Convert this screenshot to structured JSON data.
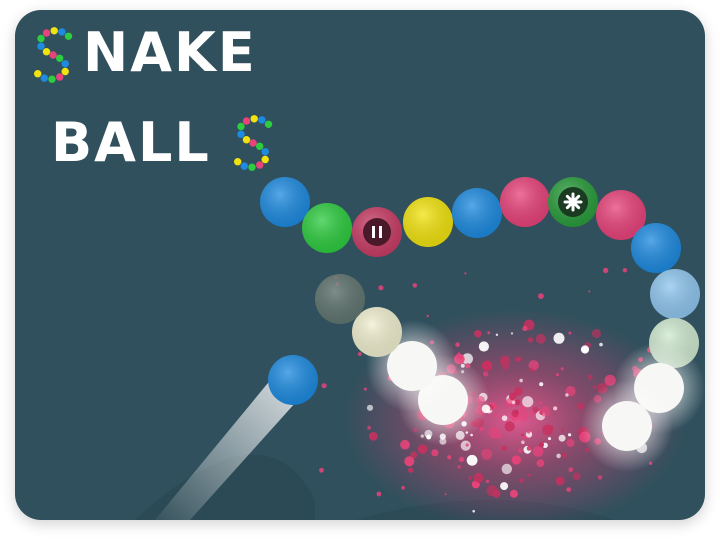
{
  "title": {
    "line1_letters": "NAKE",
    "line2_letters": "BALL",
    "dotted_letter": "S"
  },
  "colors": {
    "background": "#31505d",
    "blue": "#1e8be0",
    "green": "#2ecc40",
    "yellow": "#f2e30f",
    "pink": "#e8437a",
    "pause_ball": "#c93d66",
    "star_ball": "#2a9d3c"
  },
  "snake_balls": [
    {
      "color": "blue"
    },
    {
      "color": "green"
    },
    {
      "color": "pink",
      "icon": "pause-icon"
    },
    {
      "color": "yellow"
    },
    {
      "color": "blue"
    },
    {
      "color": "pink"
    },
    {
      "color": "green",
      "icon": "star-icon"
    },
    {
      "color": "pink"
    },
    {
      "color": "blue"
    },
    {
      "color": "light-blue"
    },
    {
      "color": "pale-green"
    },
    {
      "color": "white"
    },
    {
      "color": "white"
    },
    {
      "color": "white"
    },
    {
      "color": "white"
    },
    {
      "color": "pale-yellow"
    },
    {
      "color": "faded-grey"
    }
  ],
  "shooter_ball": {
    "color": "blue"
  }
}
